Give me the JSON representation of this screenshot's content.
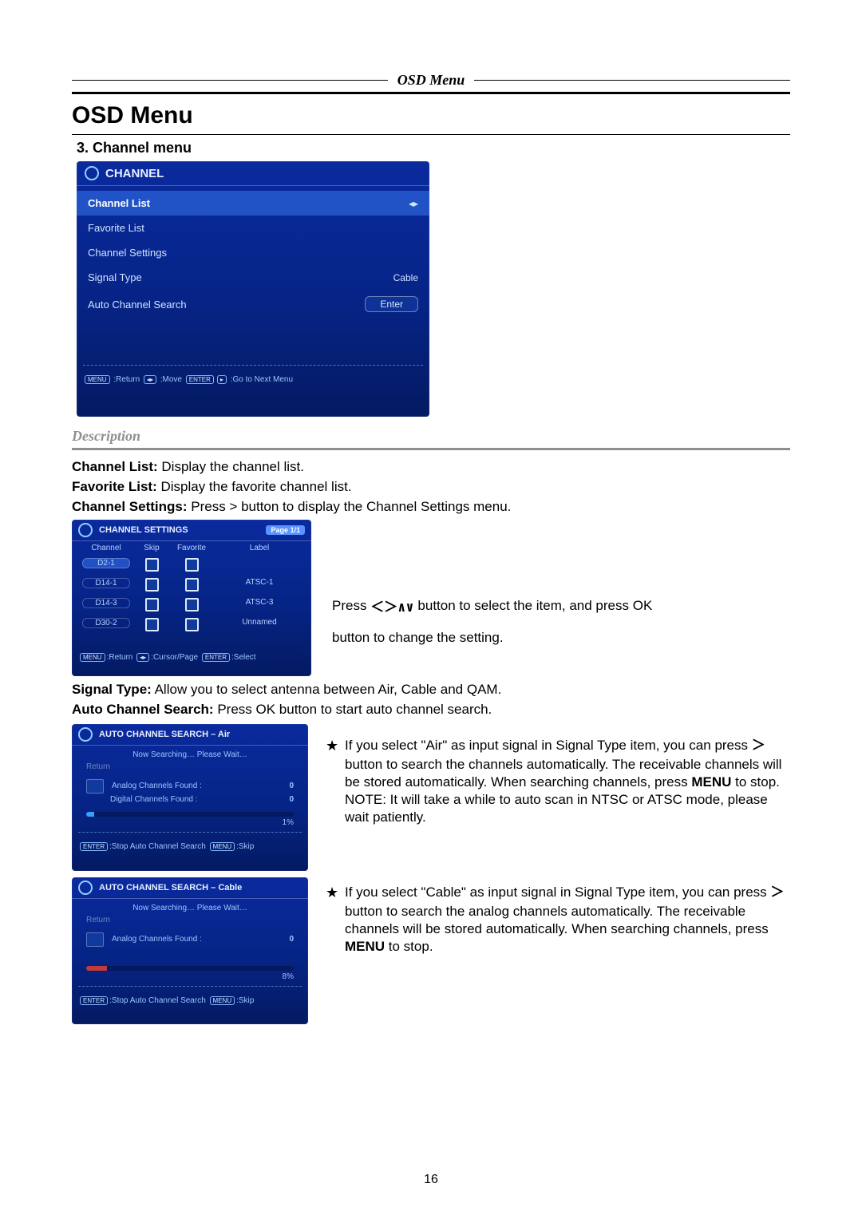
{
  "page_header": {
    "italic_title": "OSD Menu"
  },
  "titles": {
    "main": "OSD Menu",
    "section": "3. Channel menu",
    "description_heading": "Description"
  },
  "page_number": "16",
  "panel_channel": {
    "title": "CHANNEL",
    "rows": [
      {
        "label": "Channel List",
        "value": "",
        "selected": true,
        "right_arrows": true
      },
      {
        "label": "Favorite List",
        "value": "",
        "selected": false
      },
      {
        "label": "Channel Settings",
        "value": "",
        "selected": false
      },
      {
        "label": "Signal Type",
        "value": "Cable",
        "selected": false
      },
      {
        "label": "Auto Channel Search",
        "enter": "Enter",
        "selected": false
      }
    ],
    "legend": {
      "menu_tag": "MENU",
      "return": ":Return",
      "move": ":Move",
      "enter_tag": "ENTER",
      "goto": ":Go to Next Menu"
    }
  },
  "desc_lines": {
    "l1b": "Channel List:",
    "l1": " Display the channel list.",
    "l2b": "Favorite List:",
    "l2": " Display the favorite channel list.",
    "l3b": "Channel Settings:",
    "l3": " Press > button to display the Channel Settings menu."
  },
  "panel_settings": {
    "title": "CHANNEL SETTINGS",
    "page_badge": "Page 1/1",
    "headers": {
      "ch": "Channel",
      "skip": "Skip",
      "fav": "Favorite",
      "label": "Label"
    },
    "rows": [
      {
        "ch": "D2-1",
        "label": "",
        "sel": true
      },
      {
        "ch": "D14-1",
        "label": "ATSC-1"
      },
      {
        "ch": "D14-3",
        "label": "ATSC-3"
      },
      {
        "ch": "D30-2",
        "label": "Unnamed"
      }
    ],
    "legend": {
      "menu_tag": "MENU",
      "return": ":Return",
      "cursor": ":Cursor/Page",
      "enter_tag": "ENTER",
      "select": ":Select"
    }
  },
  "settings_side_text": {
    "line1_a": "Press ",
    "arrows": "＜＞∧∨",
    "line1_b": " button to select the item, and press OK",
    "line2": "button to change the setting."
  },
  "after_settings": {
    "l1b": "Signal Type:",
    "l1": " Allow you to select antenna between Air, Cable and QAM.",
    "l2b": "Auto Channel Search:",
    "l2": " Press OK button to start auto channel search."
  },
  "panel_air": {
    "title": "AUTO CHANNEL SEARCH – Air",
    "now": "Now Searching… Please Wait…",
    "return": "Return",
    "found": [
      {
        "k": "Analog Channels Found :",
        "v": "0"
      },
      {
        "k": "Digital Channels Found :",
        "v": "0"
      }
    ],
    "pct": "1%",
    "legend": {
      "enter_tag": "ENTER",
      "stop": ":Stop Auto Channel Search",
      "menu_tag": "MENU",
      "skip": ":Skip"
    }
  },
  "panel_cable": {
    "title": "AUTO CHANNEL SEARCH – Cable",
    "now": "Now Searching… Please Wait…",
    "return": "Return",
    "found": [
      {
        "k": "Analog Channels Found :",
        "v": "0"
      }
    ],
    "pct": "8%",
    "legend": {
      "enter_tag": "ENTER",
      "stop": ":Stop Auto Channel Search",
      "menu_tag": "MENU",
      "skip": ":Skip"
    }
  },
  "air_text": {
    "p1a": "If you select \"Air\" as input signal in Signal Type item, you can press ",
    "gt": "＞",
    "p1b": " button to search the channels automatically. The receivable channels will be stored automatically. When searching channels, press ",
    "menu": "MENU",
    "p1c": " to stop.",
    "note": "NOTE: It will take a while to auto scan in NTSC or ATSC mode, please wait patiently."
  },
  "cable_text": {
    "p1a": "If you select \"Cable\" as input signal in Signal Type item, you can press ",
    "gt": "＞",
    "p1b": " button to search the analog channels automatically. The receivable channels will be stored automatically. When searching channels, press ",
    "menu": "MENU",
    "p1c": " to stop."
  },
  "glyphs": {
    "star": "★"
  }
}
